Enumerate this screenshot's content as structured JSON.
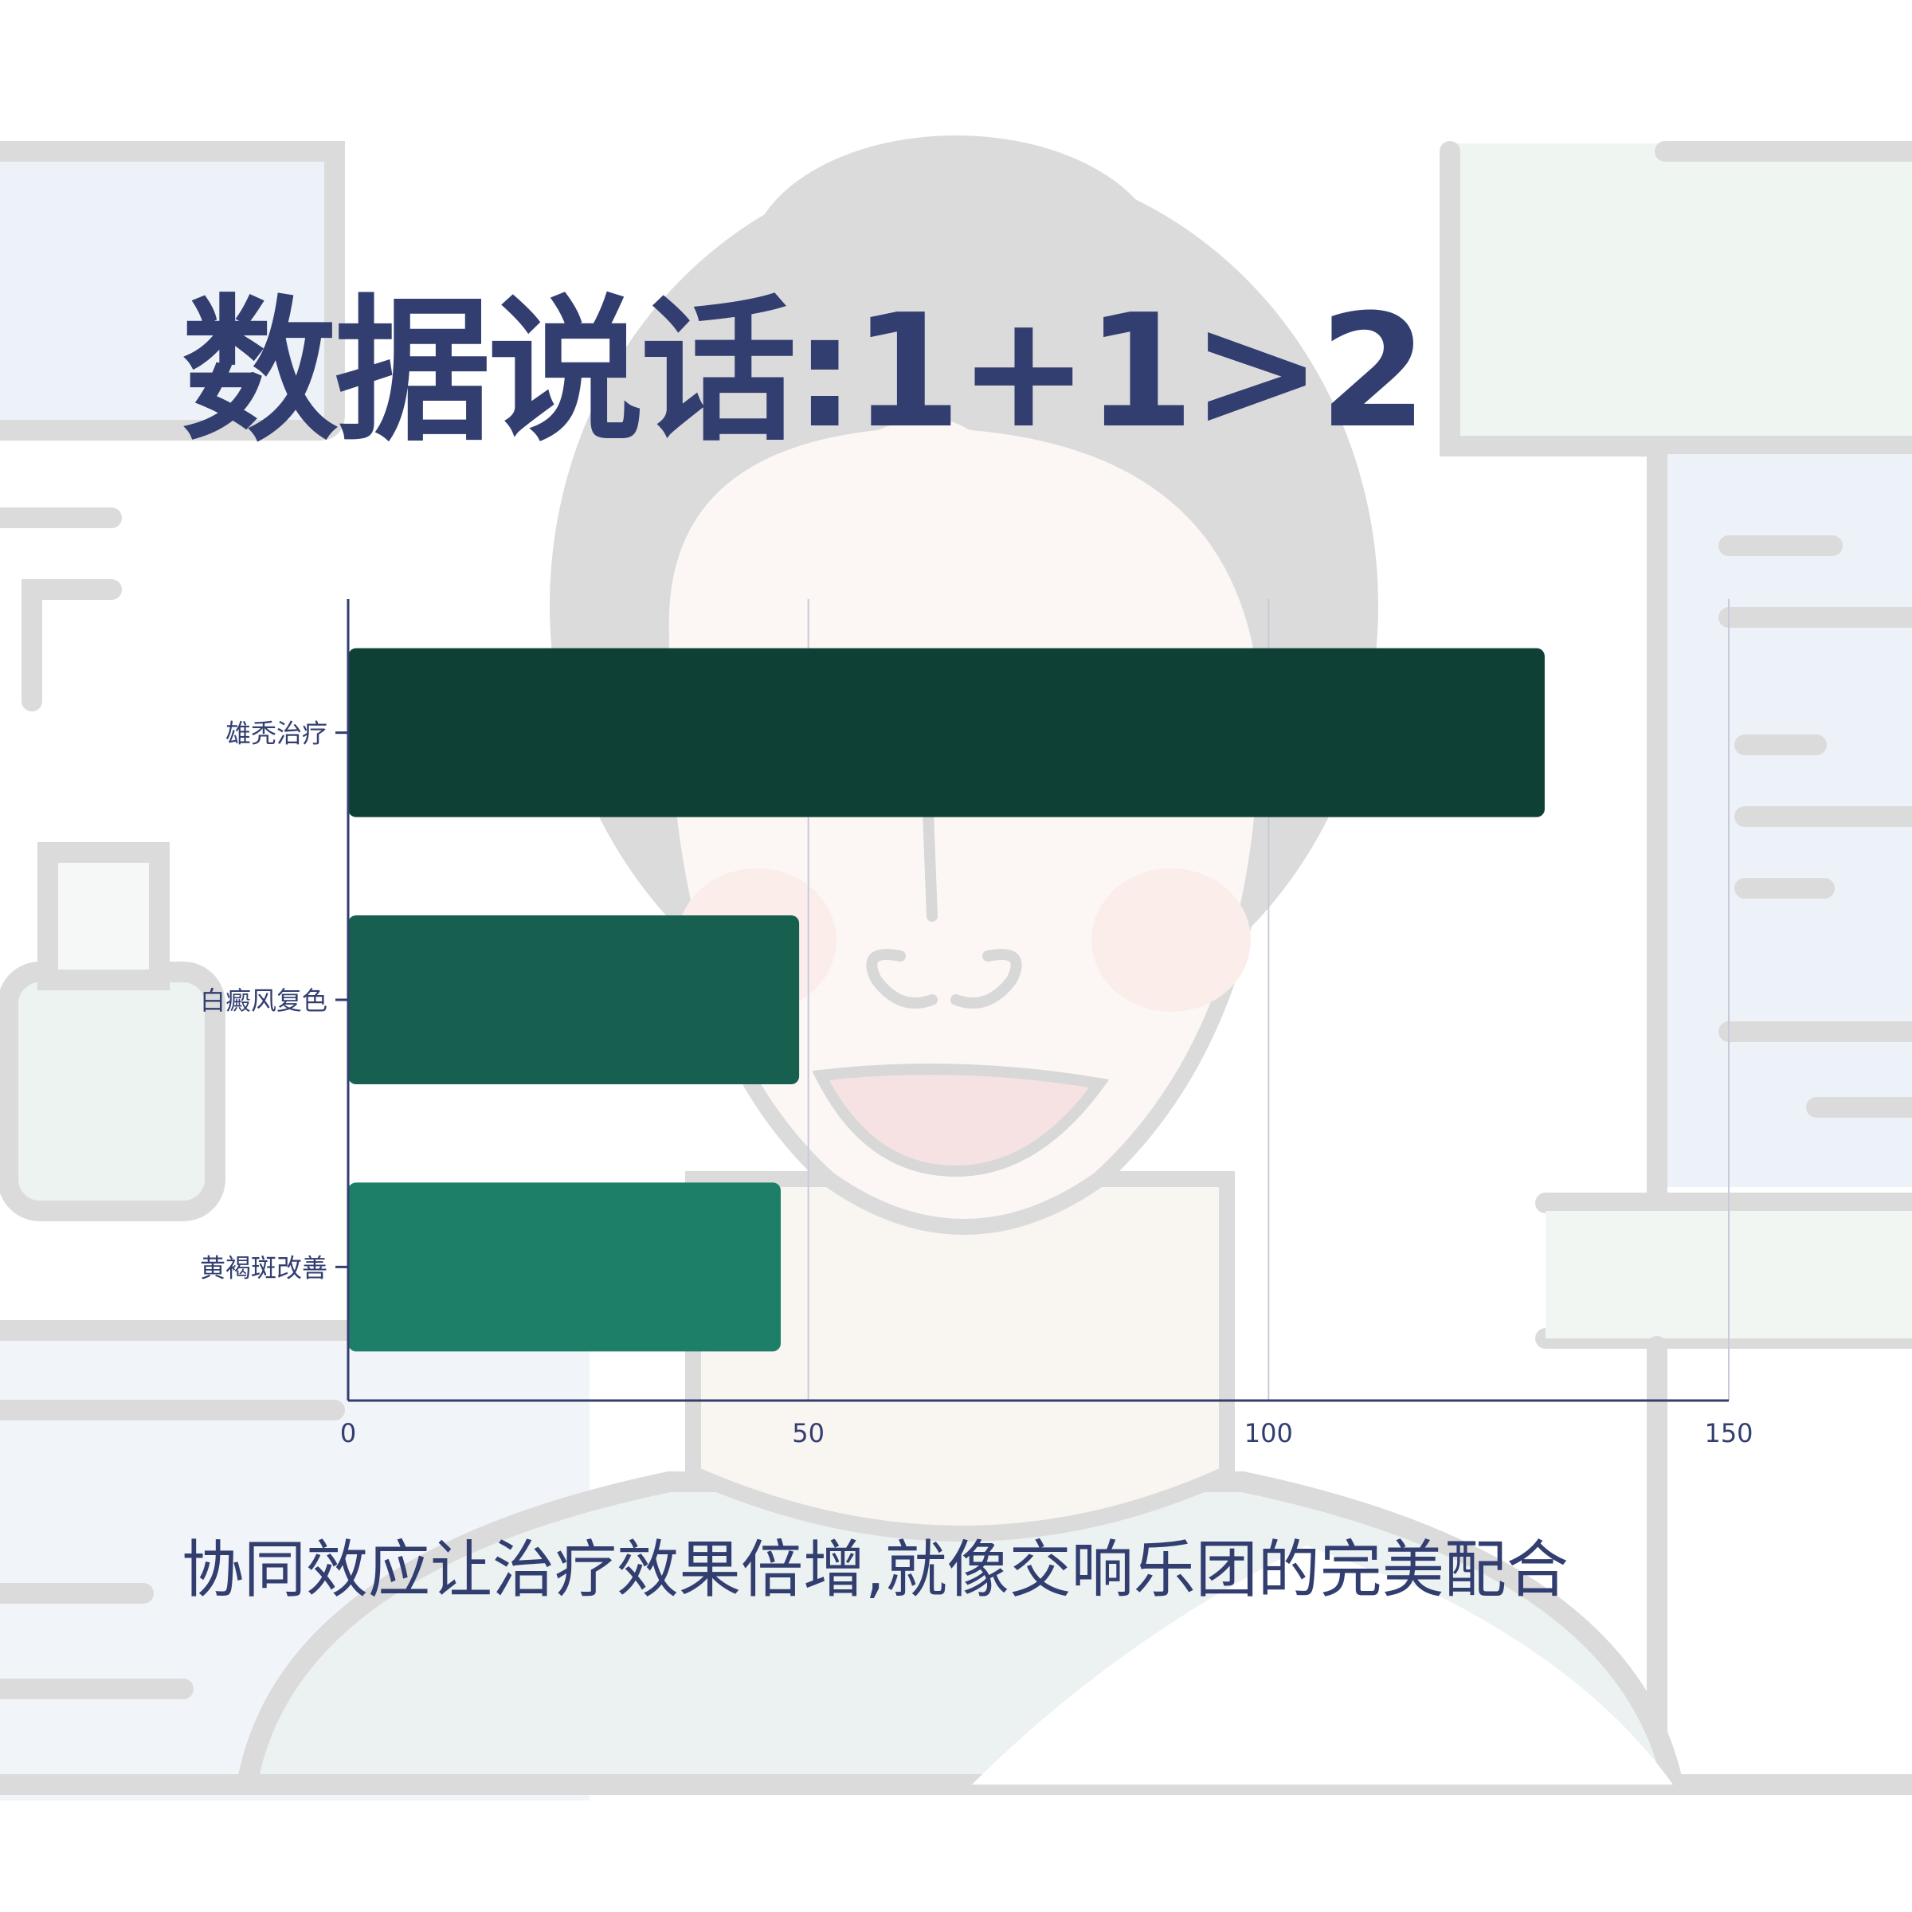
{
  "title": "数据说话:1+1>2",
  "subtitle": "协同效应让治疗效果倍增,就像交响乐团的完美配合",
  "colors": {
    "text": "#323e70",
    "grid": "#c9c9d9",
    "bar_1": "#0f4035",
    "bar_2": "#175f4f",
    "bar_3": "#1e7f69",
    "bg_line": "#d4d4d4",
    "bg_fill_blue": "#eaf0f7",
    "bg_fill_green": "#e8f1ee",
    "bg_skin": "#fcf6f2"
  },
  "background_illustration": "faded-woman-face-clinic-illustration",
  "chart_data": {
    "type": "bar",
    "orientation": "horizontal",
    "categories": [
      "雄秃治疗",
      "白癜风复色",
      "黄褐斑改善"
    ],
    "values": [
      130,
      49,
      47
    ],
    "xlim": [
      0,
      150
    ],
    "xticks": [
      0,
      50,
      100,
      150
    ],
    "xlabel": "",
    "ylabel": "",
    "grid": "vertical",
    "legend": "none"
  }
}
